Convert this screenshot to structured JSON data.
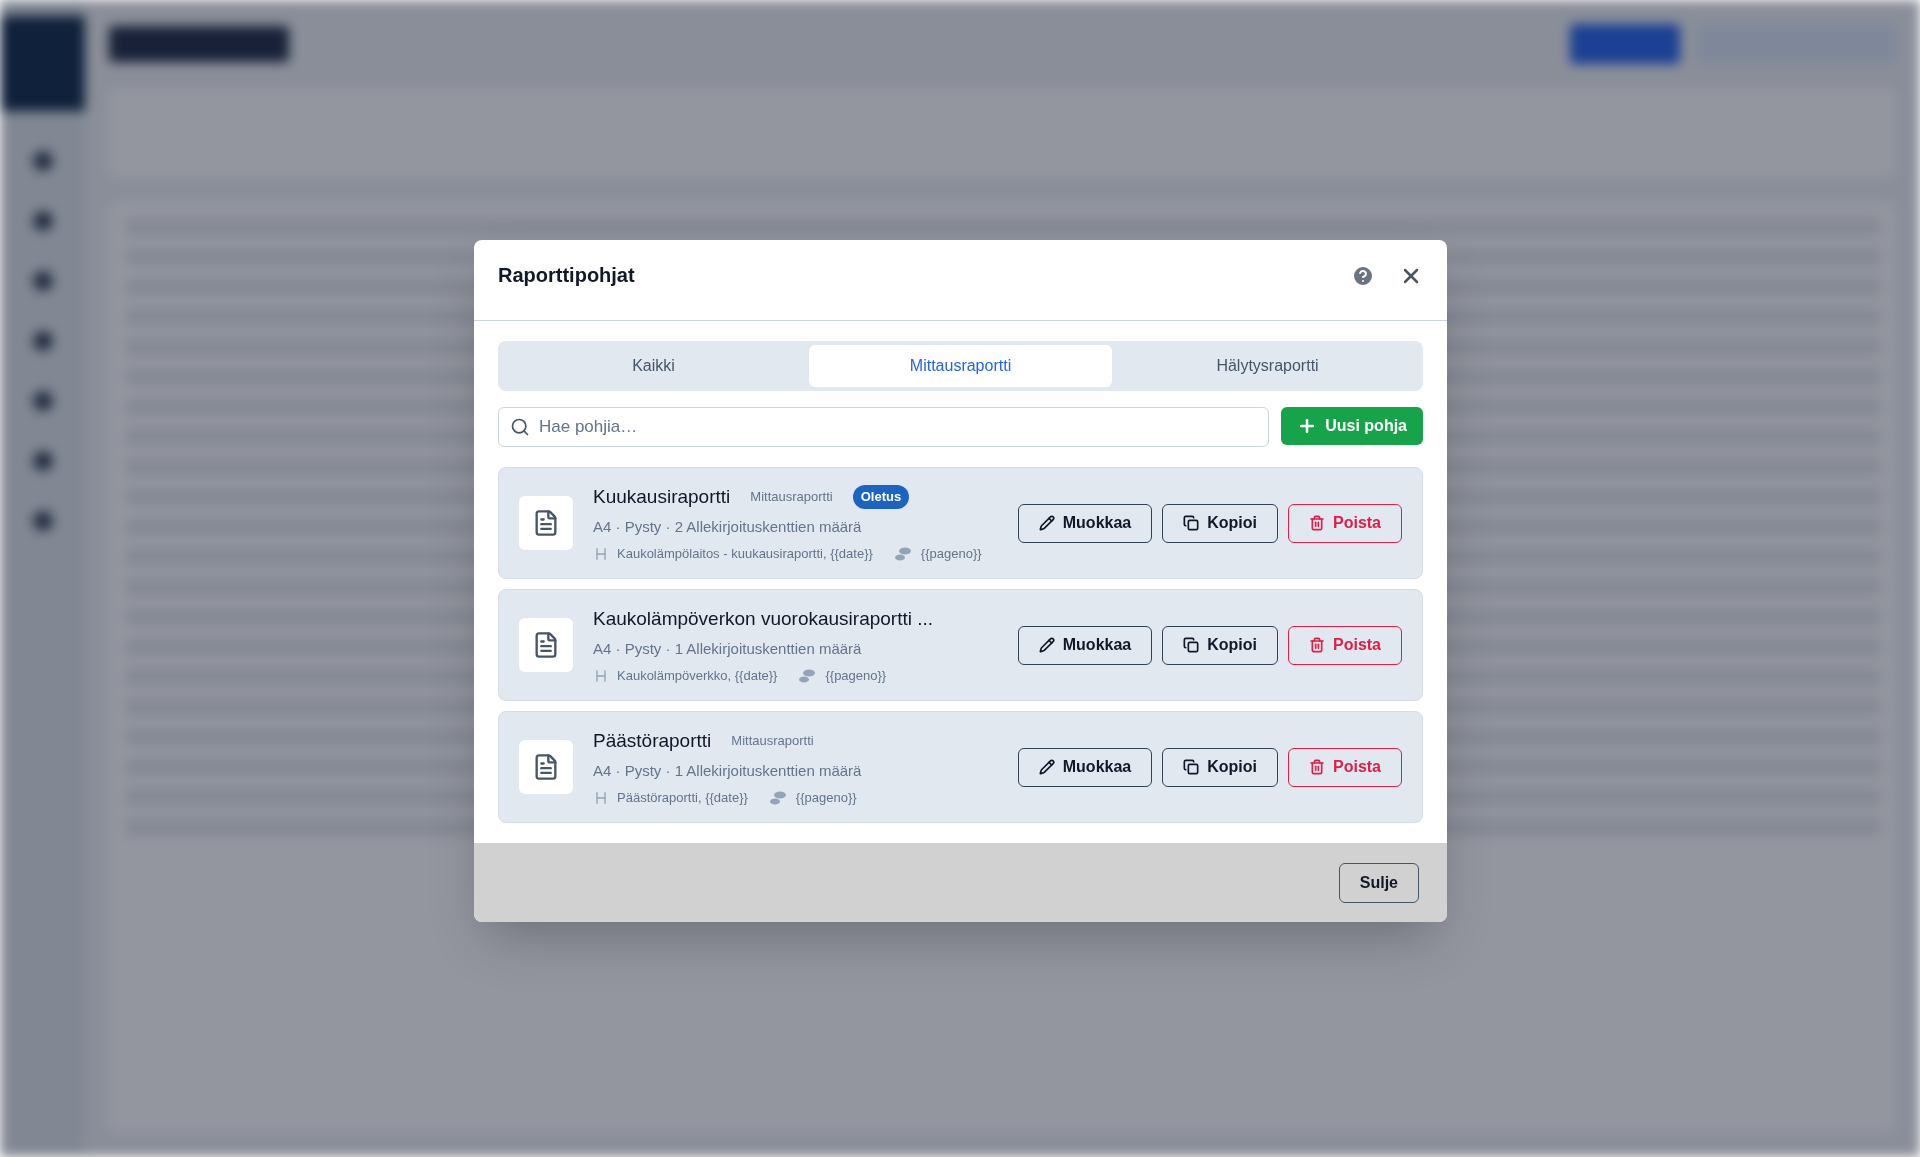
{
  "dialog": {
    "title": "Raporttipohjat",
    "tabs": [
      {
        "label": "Kaikki",
        "selected": false
      },
      {
        "label": "Mittausraportti",
        "selected": true
      },
      {
        "label": "Hälytysraportti",
        "selected": false
      }
    ],
    "search": {
      "placeholder": "Hae pohjia…"
    },
    "new_button": "Uusi pohja",
    "templates": [
      {
        "name": "Kuukausiraportti",
        "type": "Mittausraportti",
        "default": true,
        "default_label": "Oletus",
        "meta": "A4 · Pysty · 2 Allekirjoituskenttien määrä",
        "header": "Kaukolämpölaitos - kuukausiraportti, {{date}}",
        "footer": "{{pageno}}",
        "actions": [
          "Muokkaa",
          "Kopioi",
          "Poista"
        ]
      },
      {
        "name": "Kaukolämpöverkon vuorokausiraportti ...",
        "default": false,
        "meta": "A4 · Pysty · 1 Allekirjoituskenttien määrä",
        "header": "Kaukolämpöverkko, {{date}}",
        "footer": "{{pageno}}",
        "actions": [
          "Muokkaa",
          "Kopioi",
          "Poista"
        ]
      },
      {
        "name": "Päästöraportti",
        "type": "Mittausraportti",
        "default": false,
        "meta": "A4 · Pysty · 1 Allekirjoituskenttien määrä",
        "header": "Päästöraportti, {{date}}",
        "footer": "{{pageno}}",
        "actions": [
          "Muokkaa",
          "Kopioi",
          "Poista"
        ]
      }
    ],
    "close_button": "Sulje"
  }
}
